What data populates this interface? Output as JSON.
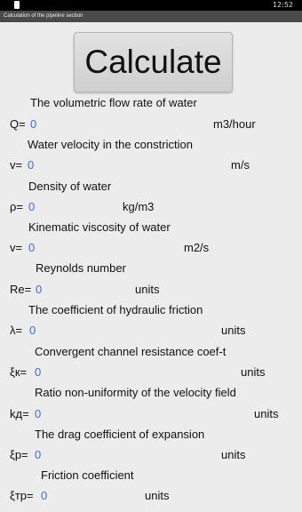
{
  "status_bar": {
    "time": "12:52"
  },
  "title_bar": {
    "title": "Calculation of the pipeline section"
  },
  "calculate_button": {
    "label": "Calculate"
  },
  "params": [
    {
      "label": "The volumetric flow rate of water",
      "symbol": "Q=",
      "value": "0",
      "unit": "m3/hour"
    },
    {
      "label": "Water velocity in the constriction",
      "symbol": "v=",
      "value": "0",
      "unit": "m/s"
    },
    {
      "label": "Density of water",
      "symbol": "ρ=",
      "value": "0",
      "unit": "kg/m3"
    },
    {
      "label": "Kinematic viscosity of water",
      "symbol": "v=",
      "value": "0",
      "unit": "m2/s"
    },
    {
      "label": "Reynolds number",
      "symbol": "Re=",
      "value": "0",
      "unit": "units"
    },
    {
      "label": "The coefficient of hydraulic friction",
      "symbol": "λ=",
      "value": "0",
      "unit": "units"
    },
    {
      "label": "Convergent channel resistance coef-t",
      "symbol": "ξк=",
      "value": "0",
      "unit": "units"
    },
    {
      "label": "Ratio non-uniformity of the velocity field",
      "symbol": "kд=",
      "value": "0",
      "unit": "units"
    },
    {
      "label": "The drag coefficient of expansion",
      "symbol": "ξр=",
      "value": "0",
      "unit": "units"
    },
    {
      "label": "Friction coefficient",
      "symbol": "ξтр=",
      "value": "0",
      "unit": "units"
    }
  ]
}
